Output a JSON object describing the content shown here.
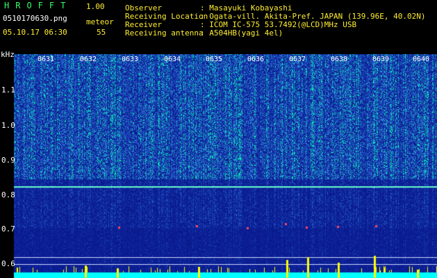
{
  "header": {
    "logo": "HROFFT",
    "version": "1.00",
    "filename": "0510170630.png",
    "meteor_label": "meteor",
    "timestamp": "05.10.17 06:30",
    "meteor_count": "55",
    "info": [
      {
        "label": "Observer",
        "value": ": Masayuki Kobayashi"
      },
      {
        "label": "Receiving Location",
        "value": ": Ogata-vill. Akita-Pref. JAPAN (139.96E, 40.02N)"
      },
      {
        "label": "Receiver",
        "value": ": ICOM IC-575 53.7492(@LCD)MHz USB"
      },
      {
        "label": "Receiving antenna",
        "value": ": A504HB(yagi 4el)"
      }
    ]
  },
  "spectrogram": {
    "y_unit": "kHz",
    "y_ticks": [
      "1.1",
      "1.0",
      "0.9",
      "0.8",
      "0.7",
      "0.6"
    ],
    "x_ticks": [
      "0631",
      "0632",
      "0633",
      "0634",
      "0635",
      "0636",
      "0637",
      "0638",
      "0639",
      "0640"
    ],
    "colors": {
      "background": "#0a1a8c",
      "noise_high": "#2f7fd8",
      "noise_peak": "#00ffb0",
      "carrier": "#66ffcc",
      "level_bar": "#00ffff",
      "meteor_spike": "#ffff00"
    }
  }
}
